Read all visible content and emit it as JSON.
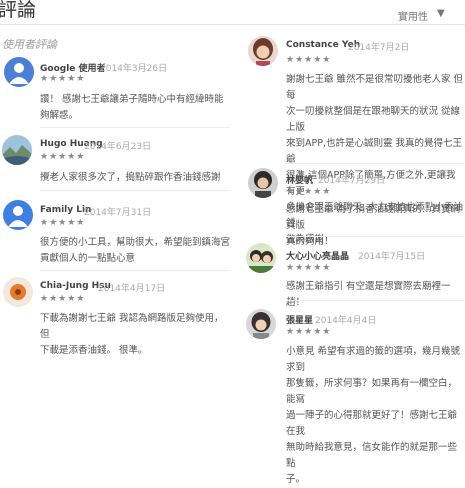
{
  "header": {
    "title": "評論",
    "sort_label": "實用性",
    "sort_arrow": "▼"
  },
  "section_title": "使用者評論",
  "left_reviews": [
    {
      "name": "Google 使用者",
      "date": "2014年3月26日",
      "stars": "★★★★★",
      "lines": [
        "讚！ 感謝七王爺讓弟子隨時心中有經緯時能",
        "夠解惑。"
      ]
    },
    {
      "name": "Hugo Huang",
      "date": "2014年6月23日",
      "stars": "★★★★★",
      "lines": [
        "攪老人家很多次了，搗點碎跟作香油錢感謝"
      ]
    },
    {
      "name": "Family Lin",
      "date": "2014年7月31日",
      "stars": "★★★★★",
      "lines": [
        "很方便的小工具，幫助很大，希望能到鎮海宮",
        "貢獻個人的一點點心意"
      ]
    },
    {
      "name": "Chia-Jung Hsu",
      "date": "2014年4月17日",
      "stars": "★★★★★",
      "lines": [
        "下載為謝謝七王爺 我認為網路版足夠使用，但",
        "下載是添香油錢。 很準。"
      ]
    }
  ],
  "right_reviews": [
    {
      "name": "Constance Yeh",
      "date": "2014年7月2日",
      "stars": "★★★★★",
      "lines": [
        "謝謝七王爺 雖然不是很常叨擾他老人家 但每",
        "次一叨擾就整個是在跟祂聊天的狀況 從線上版",
        "來到APP,也許是心誠則靈 我真的覺得七王爺",
        "很準 這個APP除了簡單,方便之外,更讓我有更",
        "多機會跟王爺聊天. 大力支持也添點小香油錢",
        "做為感謝"
      ]
    },
    {
      "name": "林嬰帆",
      "date": "2014年7月29日",
      "stars": "★★★★★",
      "lines": [
        "感謝七王爺 為了捐香油錢購買的…其實網頁版",
        "真的夠用！"
      ]
    },
    {
      "name": "大心小心亮晶晶",
      "date": "2014年7月15日",
      "stars": "★★★★★",
      "lines": [
        "感謝王爺指引 有空還是想實際去廟裡一趟！"
      ]
    },
    {
      "name": "張星星",
      "date": "2014年4月4日",
      "stars": "★★★★★",
      "lines": [
        "小意見 希望有求過的籤的選項，幾月幾號求到",
        "那隻籤，所求何事？如果再有一欄空白，能寫",
        "過一陣子的心得那就更好了！感謝七王爺在我",
        "無助時給我意見，信女能作的就是那一些點",
        "子。"
      ]
    }
  ],
  "colors": {
    "google_avatar": "#4b80d6",
    "family_avatar": "#3f7fe0",
    "chia_avatar": "#e47b2f"
  }
}
